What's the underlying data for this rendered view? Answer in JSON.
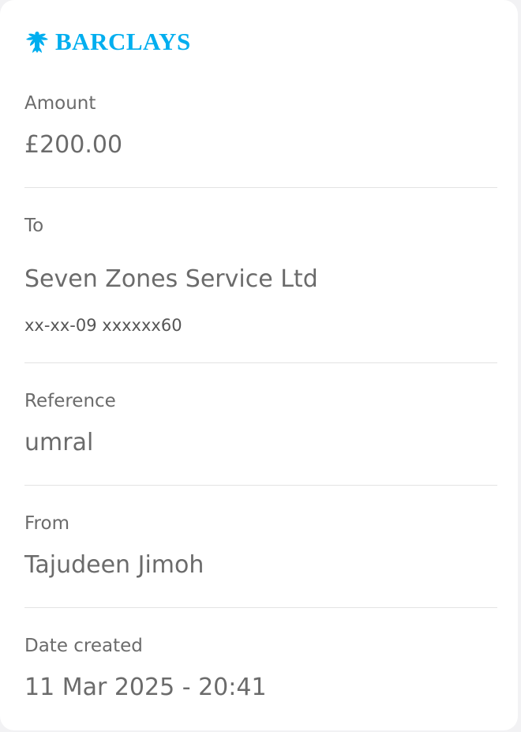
{
  "brand": {
    "name": "BARCLAYS",
    "icon": "eagle-icon",
    "color": "#00aeef"
  },
  "amount": {
    "label": "Amount",
    "value": "£200.00"
  },
  "to": {
    "label": "To",
    "name": "Seven Zones Service Ltd",
    "account": "xx-xx-09 xxxxxx60"
  },
  "reference": {
    "label": "Reference",
    "value": "umral"
  },
  "from": {
    "label": "From",
    "value": "Tajudeen Jimoh"
  },
  "date_created": {
    "label": "Date created",
    "value": "11 Mar 2025 - 20:41"
  }
}
